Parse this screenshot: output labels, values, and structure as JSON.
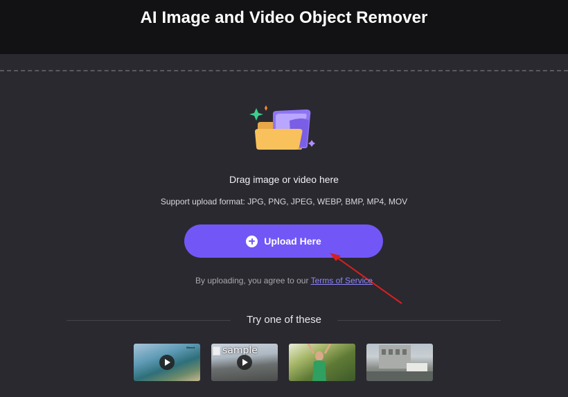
{
  "header": {
    "title": "AI Image and Video Object Remover"
  },
  "dropzone": {
    "drag_text": "Drag image or video here",
    "formats": "Support upload format: JPG, PNG, JPEG, WEBP, BMP, MP4, MOV",
    "upload_label": "Upload Here",
    "agree_text": "By uploading, you agree to our ",
    "tos_label": "Terms of Service"
  },
  "samples": {
    "title": "Try one of these",
    "items": [
      {
        "kind": "video",
        "icon": "play-icon",
        "watermark": "Wecut"
      },
      {
        "kind": "video",
        "icon": "play-icon",
        "alt": "sample"
      },
      {
        "kind": "image"
      },
      {
        "kind": "image"
      }
    ]
  },
  "colors": {
    "accent": "#7257f6",
    "link": "#8f87ff",
    "annotation_arrow": "#d8201e"
  }
}
